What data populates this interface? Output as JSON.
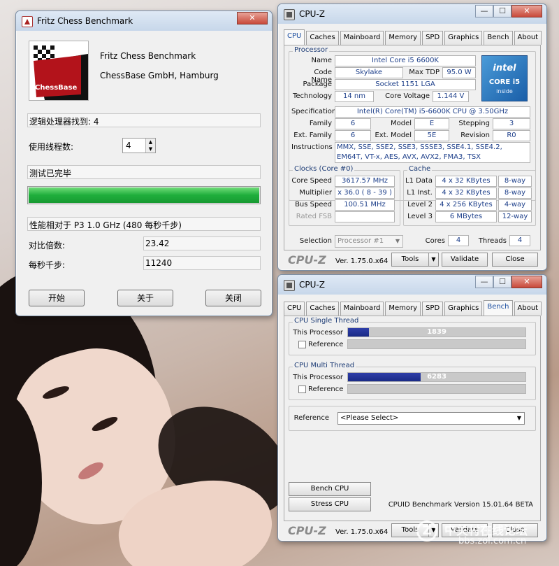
{
  "fritz": {
    "title": "Fritz Chess Benchmark",
    "logo_text": "ChessBase",
    "product": "Fritz Chess Benchmark",
    "company": "ChessBase GmbH, Hamburg",
    "processors_found": "逻辑处理器找到: 4",
    "threads_label": "使用线程数:",
    "threads_value": "4",
    "status": "测试已完毕",
    "progress": 1.0,
    "relative_label": "性能相对于 P3 1.0 GHz (480 每秒千步)",
    "ratio_label": "对比倍数:",
    "ratio_value": "23.42",
    "kns_label": "每秒千步:",
    "kns_value": "11240",
    "btn_start": "开始",
    "btn_about": "关于",
    "btn_close": "关闭"
  },
  "cpuz_top": {
    "title": "CPU-Z",
    "tabs": [
      "CPU",
      "Caches",
      "Mainboard",
      "Memory",
      "SPD",
      "Graphics",
      "Bench",
      "About"
    ],
    "active_tab": "CPU",
    "processor_group": "Processor",
    "name_label": "Name",
    "name_value": "Intel Core i5 6600K",
    "codename_label": "Code Name",
    "codename_value": "Skylake",
    "maxtdp_label": "Max TDP",
    "maxtdp_value": "95.0 W",
    "package_label": "Package",
    "package_value": "Socket 1151 LGA",
    "technology_label": "Technology",
    "technology_value": "14 nm",
    "corevoltage_label": "Core Voltage",
    "corevoltage_value": "1.144 V",
    "spec_label": "Specification",
    "spec_value": "Intel(R) Core(TM) i5-6600K CPU @ 3.50GHz",
    "family_label": "Family",
    "family_value": "6",
    "model_label": "Model",
    "model_value": "E",
    "stepping_label": "Stepping",
    "stepping_value": "3",
    "extfamily_label": "Ext. Family",
    "extfamily_value": "6",
    "extmodel_label": "Ext. Model",
    "extmodel_value": "5E",
    "revision_label": "Revision",
    "revision_value": "R0",
    "instructions_label": "Instructions",
    "instructions_value": "MMX, SSE, SSE2, SSE3, SSSE3, SSE4.1, SSE4.2, EM64T, VT-x, AES, AVX, AVX2, FMA3, TSX",
    "intel_logo_top": "intel",
    "intel_logo_mid": "CORE i5",
    "intel_logo_bottom": "inside",
    "clocks_group": "Clocks (Core #0)",
    "corespeed_label": "Core Speed",
    "corespeed_value": "3617.57 MHz",
    "multiplier_label": "Multiplier",
    "multiplier_value": "x 36.0 ( 8 - 39 )",
    "busspeed_label": "Bus Speed",
    "busspeed_value": "100.51 MHz",
    "ratedfsb_label": "Rated FSB",
    "ratedfsb_value": "",
    "cache_group": "Cache",
    "l1data_label": "L1 Data",
    "l1data_value": "4 x 32 KBytes",
    "l1data_way": "8-way",
    "l1inst_label": "L1 Inst.",
    "l1inst_value": "4 x 32 KBytes",
    "l1inst_way": "8-way",
    "level2_label": "Level 2",
    "level2_value": "4 x 256 KBytes",
    "level2_way": "4-way",
    "level3_label": "Level 3",
    "level3_value": "6 MBytes",
    "level3_way": "12-way",
    "selection_label": "Selection",
    "selection_value": "Processor #1",
    "cores_label": "Cores",
    "cores_value": "4",
    "threads_label": "Threads",
    "threads_value": "4",
    "logo": "CPU-Z",
    "version": "Ver. 1.75.0.x64",
    "tools_btn": "Tools",
    "validate_btn": "Validate",
    "close_btn": "Close"
  },
  "cpuz_bench": {
    "title": "CPU-Z",
    "tabs": [
      "CPU",
      "Caches",
      "Mainboard",
      "Memory",
      "SPD",
      "Graphics",
      "Bench",
      "About"
    ],
    "active_tab": "Bench",
    "single_group": "CPU Single Thread",
    "single_this_label": "This Processor",
    "single_this_value": "1839",
    "single_fill": 0.12,
    "single_ref_label": "Reference",
    "multi_group": "CPU Multi Thread",
    "multi_this_label": "This Processor",
    "multi_this_value": "6283",
    "multi_fill": 0.41,
    "multi_ref_label": "Reference",
    "reference_label": "Reference",
    "reference_select": "<Please Select>",
    "bench_cpu_btn": "Bench CPU",
    "stress_cpu_btn": "Stress CPU",
    "bench_version": "CPUID Benchmark Version 15.01.64 BETA",
    "logo": "CPU-Z",
    "version": "Ver. 1.75.0.x64",
    "tools_btn": "Tools",
    "validate_btn": "Validate",
    "close_btn": "Close"
  },
  "watermark": {
    "text1": "中关村在线论坛",
    "text2": "bbs.zol.com.cn"
  },
  "colors": {
    "progress_green": "#1fae3c",
    "bench_bar_blue": "#1d2c8c",
    "value_blue": "#1d3f8a"
  }
}
